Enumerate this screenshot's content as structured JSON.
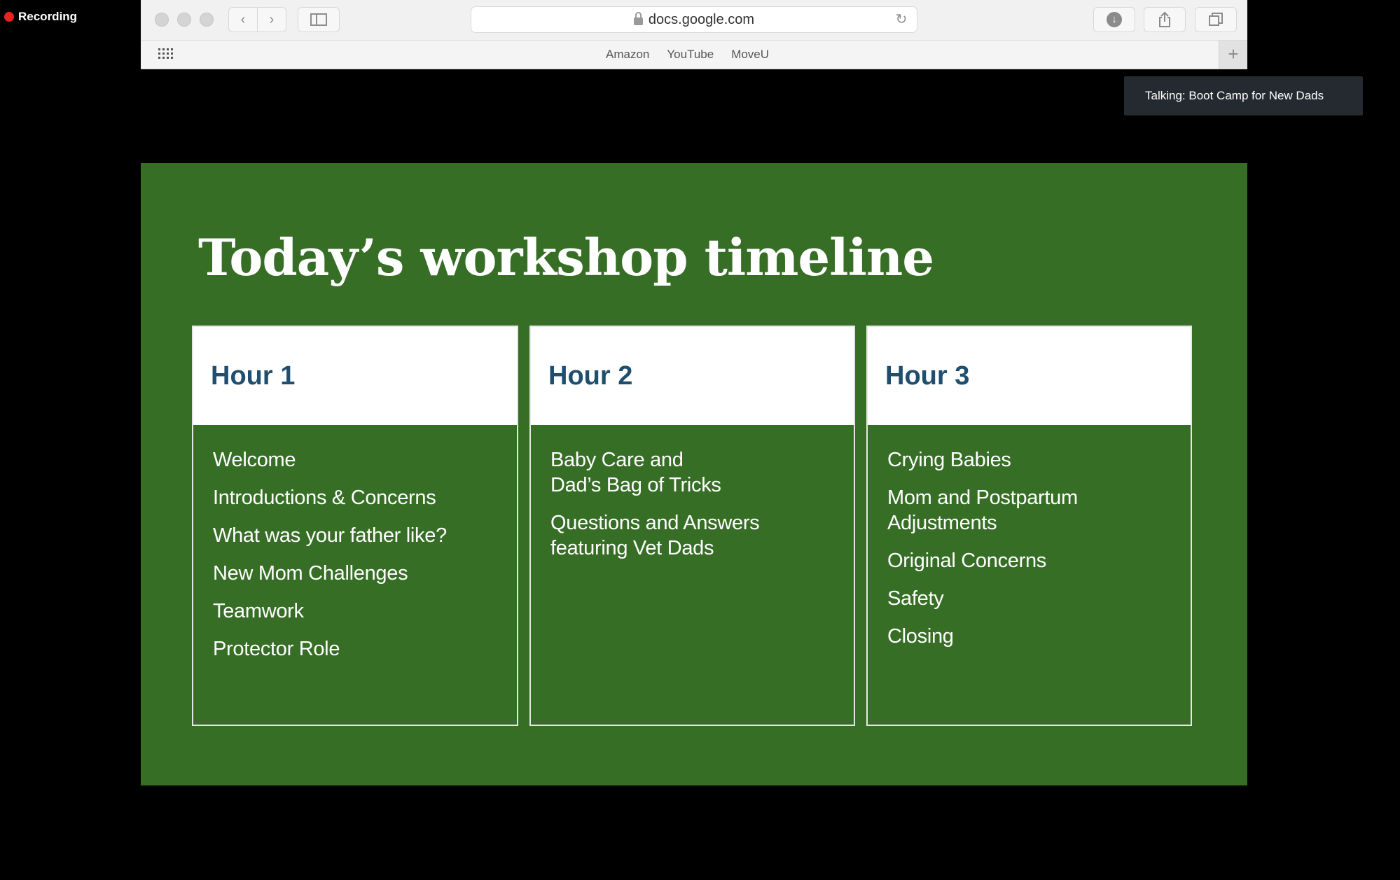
{
  "recording": {
    "label": "Recording",
    "color": "#e8231f"
  },
  "browser": {
    "url": "docs.google.com",
    "bookmarks": [
      "Amazon",
      "YouTube",
      "MoveU"
    ],
    "add_tab_glyph": "+",
    "icons": {
      "back": "chevron-left-icon",
      "forward": "chevron-right-icon",
      "sidebar": "sidebar-icon",
      "lock": "lock-icon",
      "reload": "reload-icon",
      "download": "download-icon",
      "share": "share-icon",
      "tabs": "tabs-overview-icon",
      "apps": "apps-grid-icon"
    }
  },
  "talking_indicator": {
    "text": "Talking: Boot Camp for New Dads"
  },
  "slide": {
    "background": "#376e26",
    "title": "Today’s workshop timeline",
    "columns": [
      {
        "header": "Hour 1",
        "items": [
          "Welcome",
          "Introductions & Concerns",
          "What was your father like?",
          "New Mom Challenges",
          "Teamwork",
          "Protector Role"
        ]
      },
      {
        "header": "Hour 2",
        "items": [
          "Baby Care and\nDad’s Bag of Tricks",
          "Questions and Answers\nfeaturing Vet Dads"
        ]
      },
      {
        "header": "Hour 3",
        "items": [
          "Crying Babies",
          "Mom and Postpartum\nAdjustments",
          "Original Concerns",
          "Safety",
          "Closing"
        ]
      }
    ]
  }
}
